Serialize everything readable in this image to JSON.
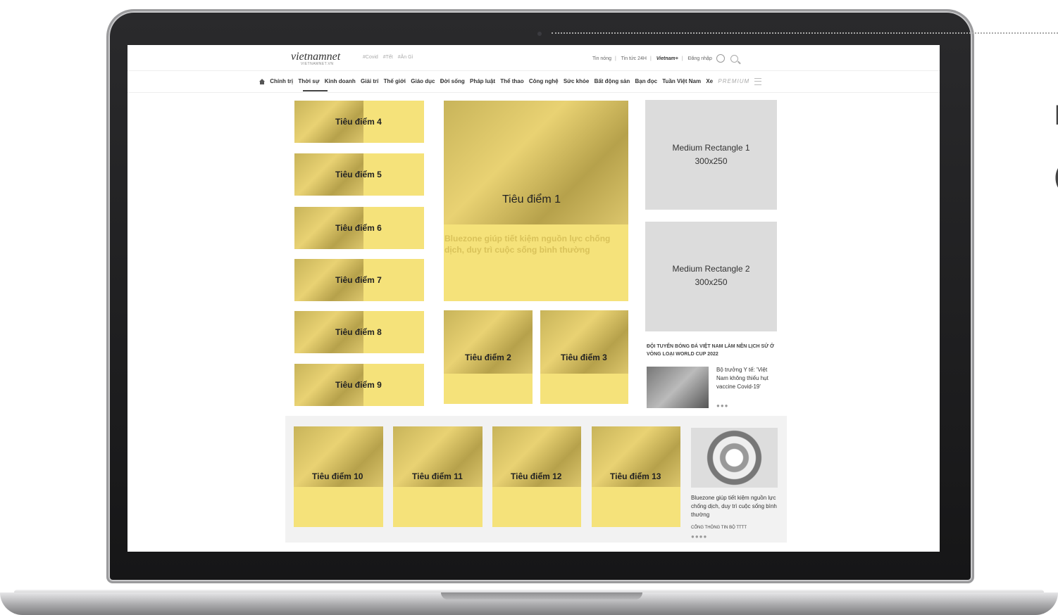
{
  "topbar": {
    "logo": "vietnamnet",
    "logo_sub": "VIETNAMNET.VN",
    "hashtags": [
      "#Covid",
      "#Tết",
      "#Ăn Gì"
    ],
    "links": [
      "Tin nóng",
      "Tin tức 24H",
      "Vietnam+",
      "Đăng nhập"
    ]
  },
  "nav": {
    "items": [
      "Chính trị",
      "Thời sự",
      "Kinh doanh",
      "Giải trí",
      "Thế giới",
      "Giáo dục",
      "Đời sống",
      "Pháp luật",
      "Thể thao",
      "Công nghệ",
      "Sức khỏe",
      "Bất động sản",
      "Bạn đọc",
      "Tuần Việt Nam",
      "Xe"
    ],
    "premium": "PREMIUM"
  },
  "main": {
    "featured_label": "Tiêu điểm 1",
    "featured_title": "Bluezone giúp tiết kiệm nguồn lực chống dịch, duy trì cuộc sống bình thường",
    "left_items": [
      "Tiêu điểm 4",
      "Tiêu điểm 5",
      "Tiêu điểm 6",
      "Tiêu điểm 7",
      "Tiêu điểm 8",
      "Tiêu điểm 9"
    ],
    "mid_items": [
      "Tiêu điểm 2",
      "Tiêu điểm 3"
    ],
    "bottom_items": [
      "Tiêu điểm 10",
      "Tiêu điểm 11",
      "Tiêu điểm 12",
      "Tiêu điểm 13"
    ]
  },
  "ads": {
    "rect1_name": "Medium Rectangle 1",
    "rect1_size": "300x250",
    "rect2_name": "Medium Rectangle 2",
    "rect2_size": "300x250"
  },
  "sidebar": {
    "section_title": "ĐỘI TUYỂN BÓNG ĐÁ VIỆT NAM LÀM NÊN LỊCH SỬ Ở VÒNG LOẠI WORLD CUP 2022",
    "story_text": "Bộ trưởng Y tế: 'Việt Nam không thiếu hụt vaccine Covid-19'",
    "bottom_story": "Bluezone giúp tiết kiệm nguồn lực chống dịch, duy trì cuộc sống bình thường",
    "bottom_source": "CỔNG THÔNG TIN BỘ TTTT"
  },
  "colors": {
    "highlight": "#f5e27a",
    "ad_grey": "#dcdcdc"
  }
}
